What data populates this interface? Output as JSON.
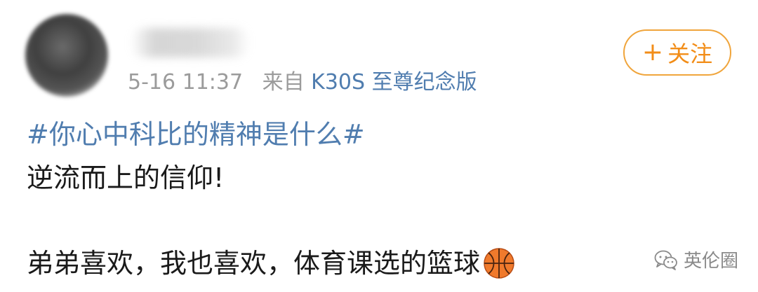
{
  "post": {
    "meta": {
      "time": "5-16 11:37",
      "source_prefix": "来自",
      "device": "K30S 至尊纪念版"
    },
    "follow_button": {
      "plus": "+",
      "label": "关注"
    },
    "topic": "#你心中科比的精神是什么#",
    "line_2": "逆流而上的信仰!",
    "line_3": "弟弟喜欢，我也喜欢，体育课选的篮球",
    "emoji": "basketball-icon"
  },
  "watermark": {
    "brand": "英伦圈",
    "icon": "wechat-icon"
  },
  "colors": {
    "link_blue": "#507daf",
    "follow_orange": "#f28d18",
    "meta_gray": "#9b9b9b"
  }
}
